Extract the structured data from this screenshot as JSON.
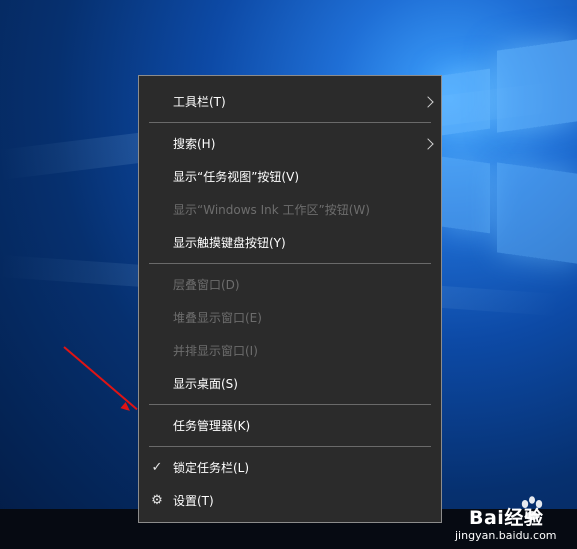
{
  "menu": {
    "items": [
      {
        "label": "工具栏(T)",
        "enabled": true,
        "submenu": true
      },
      {
        "label": "搜索(H)",
        "enabled": true,
        "submenu": true
      },
      {
        "label": "显示“任务视图”按钮(V)",
        "enabled": true
      },
      {
        "label": "显示“Windows Ink 工作区”按钮(W)",
        "enabled": false
      },
      {
        "label": "显示触摸键盘按钮(Y)",
        "enabled": true
      },
      {
        "label": "层叠窗口(D)",
        "enabled": false
      },
      {
        "label": "堆叠显示窗口(E)",
        "enabled": false
      },
      {
        "label": "并排显示窗口(I)",
        "enabled": false
      },
      {
        "label": "显示桌面(S)",
        "enabled": true
      },
      {
        "label": "任务管理器(K)",
        "enabled": true
      },
      {
        "label": "锁定任务栏(L)",
        "enabled": true,
        "checked": true
      },
      {
        "label": "设置(T)",
        "enabled": true,
        "icon": "gear-icon"
      }
    ]
  },
  "watermark": {
    "brand": "Bai经验",
    "url": "jingyan.baidu.com"
  },
  "colors": {
    "menu_bg": "#2b2b2b",
    "disabled_text": "#6d6d6d",
    "annotation_arrow": "#e01414"
  }
}
